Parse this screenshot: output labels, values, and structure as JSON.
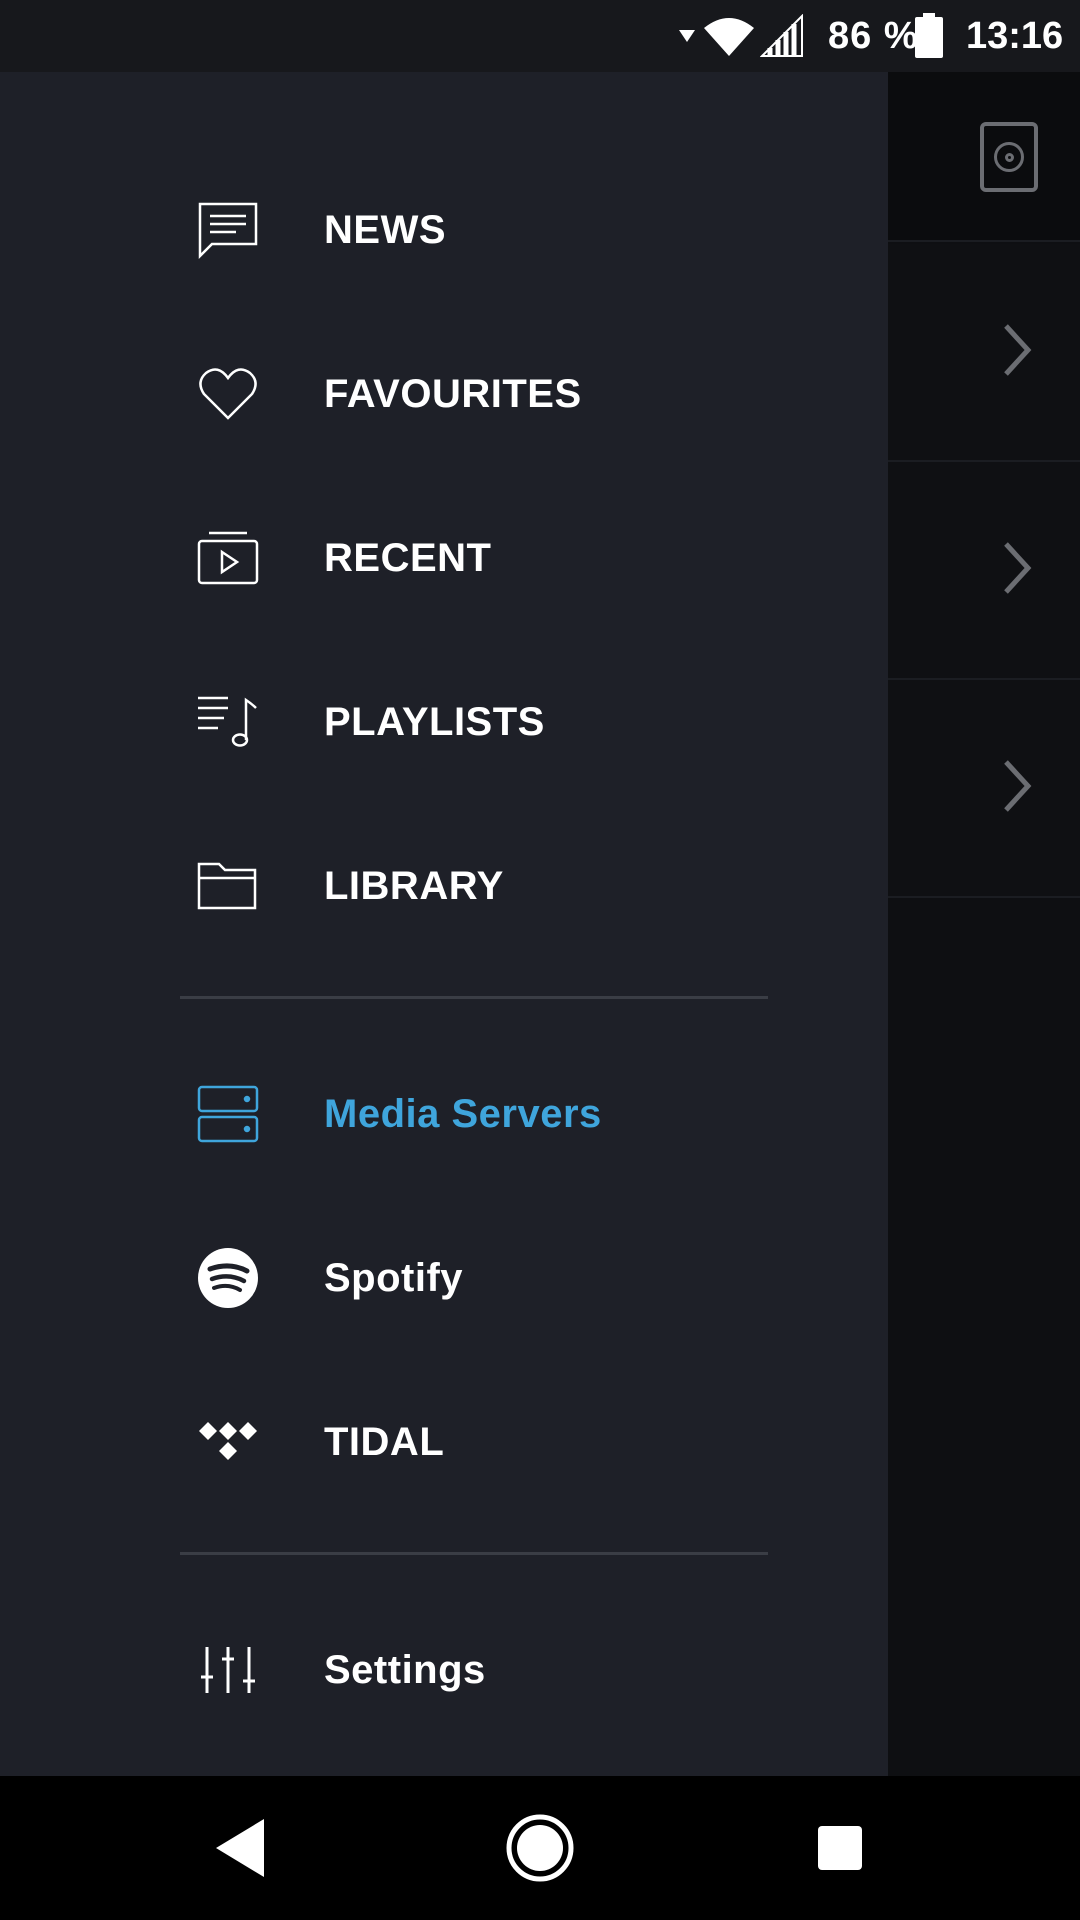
{
  "status_bar": {
    "battery_text": "86 %",
    "time": "13:16",
    "icons": [
      "dropdown-arrow-icon",
      "wifi-icon",
      "signal-icon",
      "battery-icon"
    ]
  },
  "drawer": {
    "items": [
      {
        "label": "NEWS",
        "icon": "news-icon"
      },
      {
        "label": "FAVOURITES",
        "icon": "heart-icon"
      },
      {
        "label": "RECENT",
        "icon": "recent-play-icon"
      },
      {
        "label": "PLAYLISTS",
        "icon": "playlist-icon"
      },
      {
        "label": "LIBRARY",
        "icon": "folder-icon"
      },
      {
        "label": "Media Servers",
        "icon": "server-icon",
        "active": true
      },
      {
        "label": "Spotify",
        "icon": "spotify-icon"
      },
      {
        "label": "TIDAL",
        "icon": "tidal-icon"
      },
      {
        "label": "Settings",
        "icon": "sliders-icon"
      }
    ]
  },
  "colors": {
    "drawer_bg": "#1e2028",
    "active": "#3fa5dc",
    "text": "#ffffff"
  },
  "nav_bar": {
    "buttons": [
      "back-icon",
      "home-icon",
      "recents-icon"
    ]
  }
}
